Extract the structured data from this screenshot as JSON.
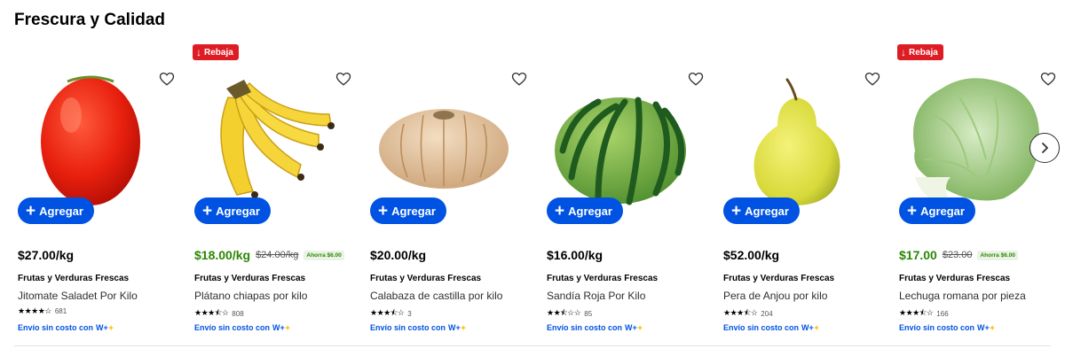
{
  "section": {
    "title": "Frescura y Calidad"
  },
  "add_label": "Agregar",
  "ship_label": "Envío sin costo con",
  "wplus_label": "W+",
  "colors": {
    "primary_blue": "#0053e2",
    "sale_green": "#2a8703",
    "badge_red": "#de1c24"
  },
  "products": [
    {
      "badge": "",
      "price": "$27.00/kg",
      "was": "",
      "save": "",
      "category": "Frutas y Verduras Frescas",
      "name": "Jitomate Saladet Por Kilo",
      "stars": "★★★★☆",
      "rating": 4.5,
      "reviews": "681",
      "image": "tomato"
    },
    {
      "badge": "Rebaja",
      "price": "$18.00/kg",
      "was": "$24.00/kg",
      "save": "Ahorra $6.00",
      "category": "Frutas y Verduras Frescas",
      "name": "Plátano chiapas por kilo",
      "stars": "★★★⯪☆",
      "rating": 3.5,
      "reviews": "808",
      "image": "banana"
    },
    {
      "badge": "",
      "price": "$20.00/kg",
      "was": "",
      "save": "",
      "category": "Frutas y Verduras Frescas",
      "name": "Calabaza de castilla por kilo",
      "stars": "★★★⯪☆",
      "rating": 3.5,
      "reviews": "3",
      "image": "pumpkin"
    },
    {
      "badge": "",
      "price": "$16.00/kg",
      "was": "",
      "save": "",
      "category": "Frutas y Verduras Frescas",
      "name": "Sandía Roja Por Kilo",
      "stars": "★★⯪☆☆",
      "rating": 2.5,
      "reviews": "85",
      "image": "watermelon"
    },
    {
      "badge": "",
      "price": "$52.00/kg",
      "was": "",
      "save": "",
      "category": "Frutas y Verduras Frescas",
      "name": "Pera de Anjou por kilo",
      "stars": "★★★⯪☆",
      "rating": 3.5,
      "reviews": "204",
      "image": "pear"
    },
    {
      "badge": "Rebaja",
      "price": "$17.00",
      "was": "$23.00",
      "save": "Ahorra $6.00",
      "category": "Frutas y Verduras Frescas",
      "name": "Lechuga romana por pieza",
      "stars": "★★★⯪☆",
      "rating": 3.5,
      "reviews": "166",
      "image": "lettuce"
    }
  ]
}
